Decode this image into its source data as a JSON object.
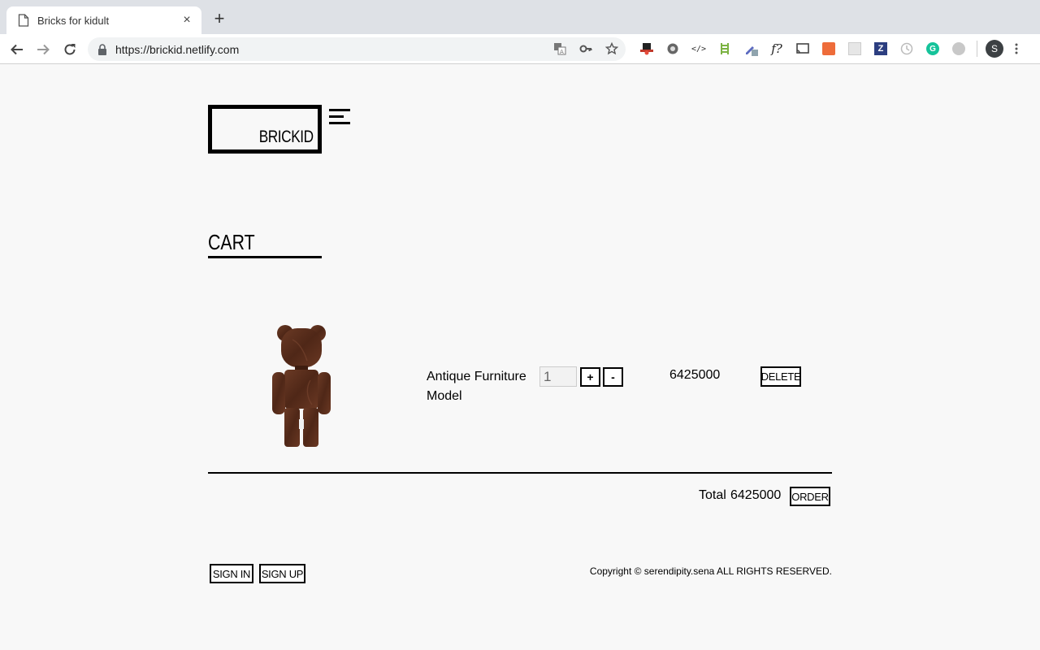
{
  "browser": {
    "tab_title": "Bricks for kidult",
    "tab_close": "×",
    "new_tab": "+",
    "url": "https://brickid.netlify.com",
    "profile_initial": "S"
  },
  "site": {
    "logo_text": "BRICKID"
  },
  "cart": {
    "title": "CART",
    "items": [
      {
        "name": "Antique Furniture Model",
        "quantity": "1",
        "increment_label": "+",
        "decrement_label": "-",
        "price": "6425000",
        "delete_label": "DELETE"
      }
    ],
    "total_label": "Total",
    "total_value": "6425000",
    "order_label": "ORDER"
  },
  "footer": {
    "sign_in": "SIGN IN",
    "sign_up": "SIGN UP",
    "copyright": "Copyright © serendipity.sena ALL RIGHTS RESERVED."
  },
  "colors": {
    "page_background": "#f8f8f8",
    "tabstrip": "#dee1e6",
    "ink": "#000000",
    "product_wood": "#5a2e1c"
  },
  "icons": {
    "tab": "page-icon",
    "back": "back-arrow-icon",
    "forward": "forward-arrow-icon",
    "reload": "reload-icon",
    "secure": "lock-icon",
    "translate": "translate-icon",
    "password": "key-icon",
    "bookmark": "star-icon",
    "menu": "hamburger-menu-icon"
  }
}
